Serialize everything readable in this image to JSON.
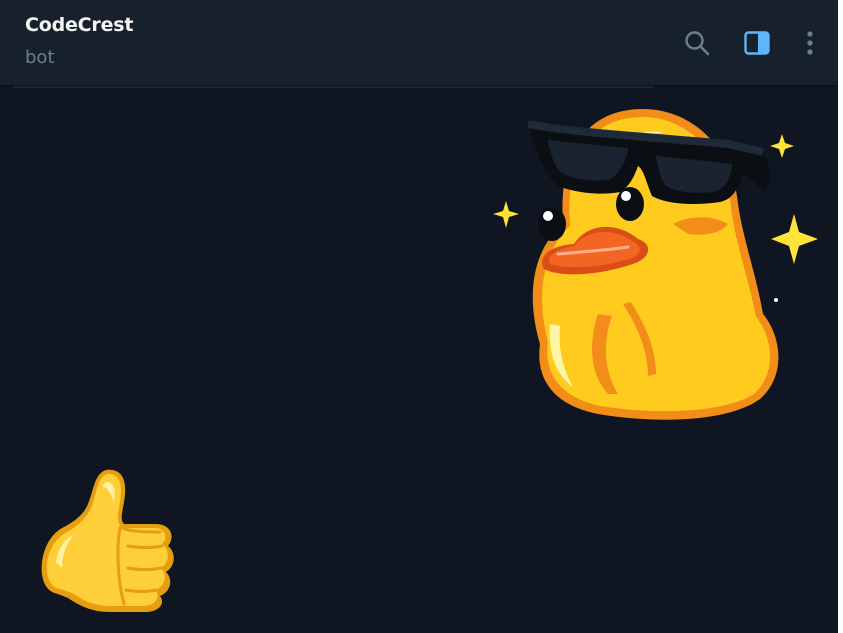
{
  "header": {
    "title": "CodeCrest",
    "subtitle": "bot",
    "actions": [
      {
        "name": "search",
        "icon": "search-icon"
      },
      {
        "name": "toggle-side-panel",
        "icon": "side-panel-icon",
        "color": "#5eb5f7"
      },
      {
        "name": "more-options",
        "icon": "more-vertical-icon"
      }
    ]
  },
  "messages": [
    {
      "type": "sticker",
      "direction": "incoming",
      "sticker": "duck-with-sunglasses"
    },
    {
      "type": "sticker",
      "direction": "outgoing",
      "sticker": "thumbs-up"
    }
  ],
  "colors": {
    "chat_background": "#0f1622",
    "header_background": "#17212b",
    "title": "#f5f5f5",
    "subtitle": "#6d7f8f",
    "icon_muted": "#6d7f8f",
    "accent": "#5eb5f7"
  }
}
